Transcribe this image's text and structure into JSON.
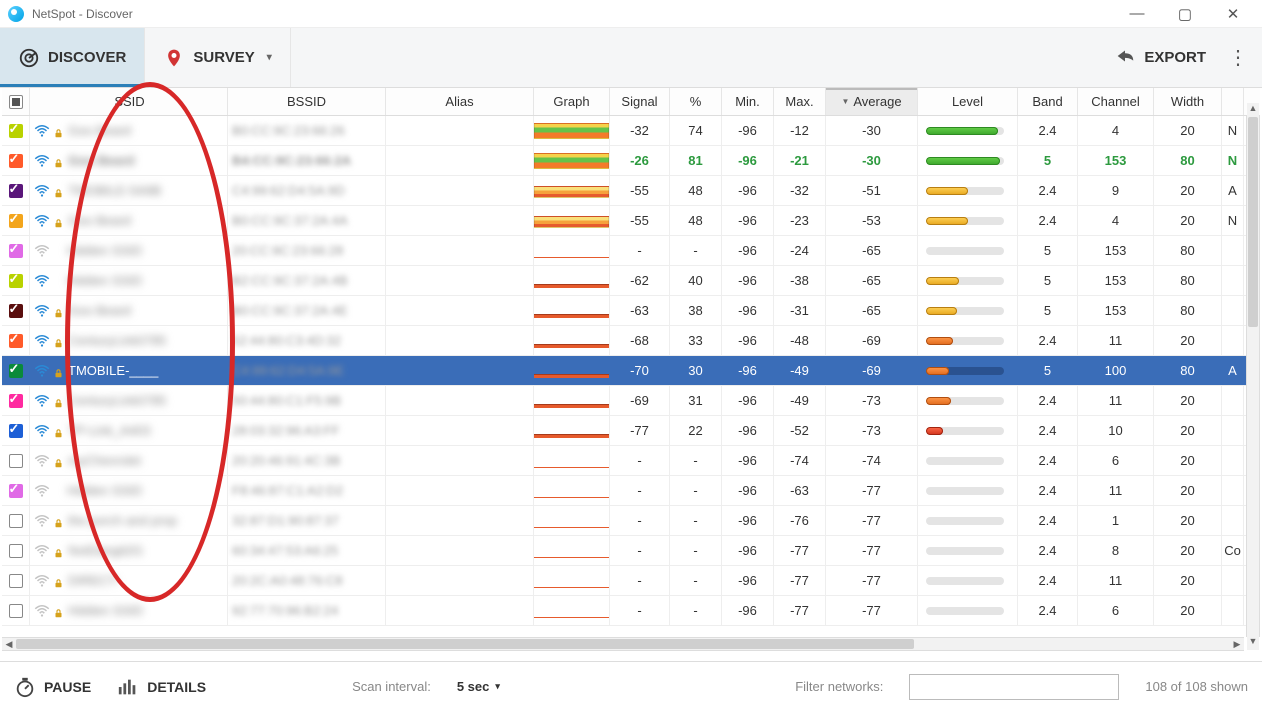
{
  "app": {
    "title": "NetSpot - Discover"
  },
  "tabs": {
    "discover": "DISCOVER",
    "survey": "SURVEY"
  },
  "export_label": "EXPORT",
  "headers": {
    "ssid": "SSID",
    "bssid": "BSSID",
    "alias": "Alias",
    "graph": "Graph",
    "signal": "Signal",
    "pct": "%",
    "min": "Min.",
    "max": "Max.",
    "average": "Average",
    "level": "Level",
    "band": "Band",
    "channel": "Channel",
    "width": "Width"
  },
  "footer": {
    "pause": "PAUSE",
    "details": "DETAILS",
    "scan_label": "Scan interval:",
    "scan_value": "5 sec",
    "filter_label": "Filter networks:",
    "filter_placeholder": "",
    "count": "108 of 108 shown"
  },
  "rows": [
    {
      "chk": true,
      "chk_color": "#b9d200",
      "ssid": "Goo Beard",
      "bssid": "B0:CC:9C:23:66:26",
      "signal": "-32",
      "pct": "74",
      "min": "-96",
      "max": "-12",
      "avg": "-30",
      "level": 92,
      "lvc": "lv-green",
      "band": "2.4",
      "ch": "4",
      "w": "20",
      "extra": "N",
      "gb": "gb-full",
      "lock": true,
      "gray": false
    },
    {
      "chk": true,
      "chk_color": "#ff5a2a",
      "green": true,
      "ssid": "Goo Beard",
      "bssid": "B4:CC:9C:23:66:2A",
      "signal": "-26",
      "pct": "81",
      "min": "-96",
      "max": "-21",
      "avg": "-30",
      "level": 95,
      "lvc": "lv-green",
      "band": "5",
      "ch": "153",
      "w": "80",
      "extra": "N",
      "gb": "gb-full",
      "lock": true,
      "gray": false
    },
    {
      "chk": true,
      "chk_color": "#5a167a",
      "ssid": "TMOBILE-5A9B",
      "bssid": "C4:99:62:D4:5A:9D",
      "signal": "-55",
      "pct": "48",
      "min": "-96",
      "max": "-32",
      "avg": "-51",
      "level": 54,
      "lvc": "lv-amber",
      "band": "2.4",
      "ch": "9",
      "w": "20",
      "extra": "A",
      "gb": "gb-mid",
      "lock": true,
      "gray": false
    },
    {
      "chk": true,
      "chk_color": "#f3a51c",
      "ssid": "Goo Beard",
      "bssid": "B0:CC:9C:37:2A:4A",
      "signal": "-55",
      "pct": "48",
      "min": "-96",
      "max": "-23",
      "avg": "-53",
      "level": 54,
      "lvc": "lv-amber",
      "band": "2.4",
      "ch": "4",
      "w": "20",
      "extra": "N",
      "gb": "gb-mid",
      "lock": true,
      "gray": false
    },
    {
      "chk": true,
      "chk_color": "#e06ae6",
      "ssid": "Hidden SSID",
      "bssid": "20:CC:9C:23:66:28",
      "signal": "-",
      "pct": "-",
      "min": "-96",
      "max": "-24",
      "avg": "-65",
      "level": 0,
      "lvc": "",
      "band": "5",
      "ch": "153",
      "w": "80",
      "extra": "",
      "gb": "gb-thin",
      "lock": false,
      "gray": true
    },
    {
      "chk": true,
      "chk_color": "#b9d200",
      "ssid": "Hidden SSID",
      "bssid": "B2:CC:9C:37:2A:4B",
      "signal": "-62",
      "pct": "40",
      "min": "-96",
      "max": "-38",
      "avg": "-65",
      "level": 42,
      "lvc": "lv-amber",
      "band": "5",
      "ch": "153",
      "w": "80",
      "extra": "",
      "gb": "gb-low",
      "lock": false,
      "gray": false
    },
    {
      "chk": true,
      "chk_color": "#5a0e0e",
      "ssid": "Goo Beard",
      "bssid": "B0:CC:9C:37:2A:4E",
      "signal": "-63",
      "pct": "38",
      "min": "-96",
      "max": "-31",
      "avg": "-65",
      "level": 40,
      "lvc": "lv-amber",
      "band": "5",
      "ch": "153",
      "w": "80",
      "extra": "",
      "gb": "gb-low",
      "lock": true,
      "gray": false
    },
    {
      "chk": true,
      "chk_color": "#ff5a2a",
      "ssid": "CenturyLink0785",
      "bssid": "52:44:80:C3:4D:32",
      "signal": "-68",
      "pct": "33",
      "min": "-96",
      "max": "-48",
      "avg": "-69",
      "level": 34,
      "lvc": "lv-orange",
      "band": "2.4",
      "ch": "11",
      "w": "20",
      "extra": "",
      "gb": "gb-low",
      "lock": true,
      "gray": false
    },
    {
      "chk": true,
      "chk_color": "#0a8a3a",
      "sel": true,
      "ssid": "TMOBILE-____",
      "bssid": "C4:99:62:D4:5A:9E",
      "signal": "-70",
      "pct": "30",
      "min": "-96",
      "max": "-49",
      "avg": "-69",
      "level": 30,
      "lvc": "lv-orange",
      "band": "5",
      "ch": "100",
      "w": "80",
      "extra": "A",
      "gb": "gb-low",
      "lock": true,
      "gray": false
    },
    {
      "chk": true,
      "chk_color": "#ff2aa0",
      "ssid": "CenturyLink0785",
      "bssid": "50:44:80:C1:F5:9B",
      "signal": "-69",
      "pct": "31",
      "min": "-96",
      "max": "-49",
      "avg": "-73",
      "level": 32,
      "lvc": "lv-orange",
      "band": "2.4",
      "ch": "11",
      "w": "20",
      "extra": "",
      "gb": "gb-low",
      "lock": true,
      "gray": false
    },
    {
      "chk": true,
      "chk_color": "#1d5fd6",
      "ssid": "TP-Link_A403",
      "bssid": "28:03:32:96:A3:FF",
      "signal": "-77",
      "pct": "22",
      "min": "-96",
      "max": "-52",
      "avg": "-73",
      "level": 22,
      "lvc": "lv-red",
      "band": "2.4",
      "ch": "10",
      "w": "20",
      "extra": "",
      "gb": "gb-low",
      "lock": true,
      "gray": false
    },
    {
      "chk": false,
      "chk_color": "",
      "ssid": "myChevrolet",
      "bssid": "20:20:46:91:4C:3B",
      "signal": "-",
      "pct": "-",
      "min": "-96",
      "max": "-74",
      "avg": "-74",
      "level": 0,
      "lvc": "",
      "band": "2.4",
      "ch": "6",
      "w": "20",
      "extra": "",
      "gb": "gb-thin",
      "lock": true,
      "gray": true
    },
    {
      "chk": true,
      "chk_color": "#e06ae6",
      "ssid": "Hidden SSID",
      "bssid": "F8:46:87:C1:A2:D2",
      "signal": "-",
      "pct": "-",
      "min": "-96",
      "max": "-63",
      "avg": "-77",
      "level": 0,
      "lvc": "",
      "band": "2.4",
      "ch": "11",
      "w": "20",
      "extra": "",
      "gb": "gb-thin",
      "lock": false,
      "gray": true
    },
    {
      "chk": false,
      "chk_color": "",
      "ssid": "the porch and prop",
      "bssid": "32:87:D1:90:87:37",
      "signal": "-",
      "pct": "-",
      "min": "-96",
      "max": "-76",
      "avg": "-77",
      "level": 0,
      "lvc": "",
      "band": "2.4",
      "ch": "1",
      "w": "20",
      "extra": "",
      "gb": "gb-thin",
      "lock": true,
      "gray": true
    },
    {
      "chk": false,
      "chk_color": "",
      "ssid": "NotDangit2G",
      "bssid": "60:34:47:53:A6:25",
      "signal": "-",
      "pct": "-",
      "min": "-96",
      "max": "-77",
      "avg": "-77",
      "level": 0,
      "lvc": "",
      "band": "2.4",
      "ch": "8",
      "w": "20",
      "extra": "Co",
      "gb": "gb-thin",
      "lock": true,
      "gray": true
    },
    {
      "chk": false,
      "chk_color": "",
      "ssid": "DIRECT-",
      "bssid": "20:2C:A0:48:76:C8",
      "signal": "-",
      "pct": "-",
      "min": "-96",
      "max": "-77",
      "avg": "-77",
      "level": 0,
      "lvc": "",
      "band": "2.4",
      "ch": "11",
      "w": "20",
      "extra": "",
      "gb": "gb-thin",
      "lock": true,
      "gray": true
    },
    {
      "chk": false,
      "chk_color": "",
      "ssid": "Hidden SSID",
      "bssid": "92:77:70:96:B2:24",
      "signal": "-",
      "pct": "-",
      "min": "-96",
      "max": "-77",
      "avg": "-77",
      "level": 0,
      "lvc": "",
      "band": "2.4",
      "ch": "6",
      "w": "20",
      "extra": "",
      "gb": "gb-thin",
      "lock": true,
      "gray": true
    }
  ]
}
